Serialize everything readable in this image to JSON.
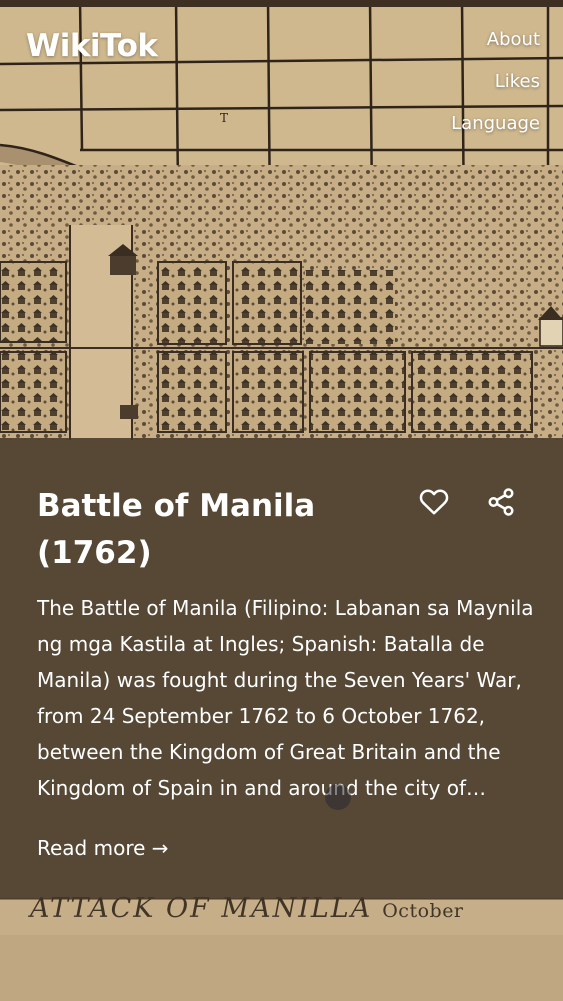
{
  "app": {
    "logo": "WikiTok"
  },
  "nav": {
    "about": "About",
    "likes": "Likes",
    "language": "Language"
  },
  "article": {
    "title": "Battle of Manila (1762)",
    "extract": "The Battle of Manila (Filipino: Labanan sa Maynila ng mga Kastila at Ingles; Spanish: Batalla de Manila) was fought during the Seven Years' War, from 24 September 1762 to 6 October 1762, between the Kingdom of Great Britain and the Kingdom of Spain in and around the city of Manila.",
    "read_more": "Read more →",
    "like_icon": "heart-outline",
    "share_icon": "share-nodes"
  },
  "background_image": {
    "caption_main": "ATTACK OF MANILLA",
    "caption_side": "October"
  },
  "colors": {
    "panel_overlay": "#443628",
    "text": "#ffffff",
    "map_paper": "#cdb58c",
    "map_ink": "#2f241a"
  }
}
